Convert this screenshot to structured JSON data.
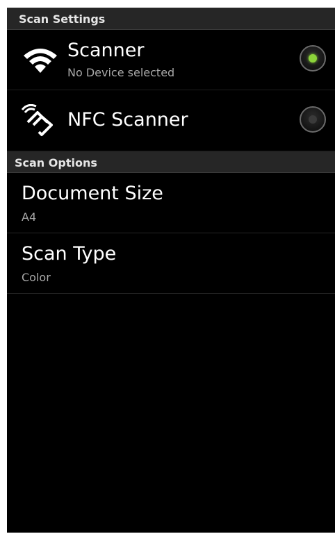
{
  "scan_settings": {
    "header": "Scan Settings",
    "items": [
      {
        "title": "Scanner",
        "subtitle": "No Device selected",
        "icon": "wifi-icon",
        "selected": true
      },
      {
        "title": "NFC Scanner",
        "icon": "nfc-icon",
        "selected": false
      }
    ]
  },
  "scan_options": {
    "header": "Scan Options",
    "items": [
      {
        "title": "Document Size",
        "value": "A4"
      },
      {
        "title": "Scan Type",
        "value": "Color"
      }
    ]
  },
  "colors": {
    "background": "#000000",
    "header_background": "#262626",
    "radio_selected": "#8cd43a",
    "subtitle_text": "#a8a8a8"
  }
}
